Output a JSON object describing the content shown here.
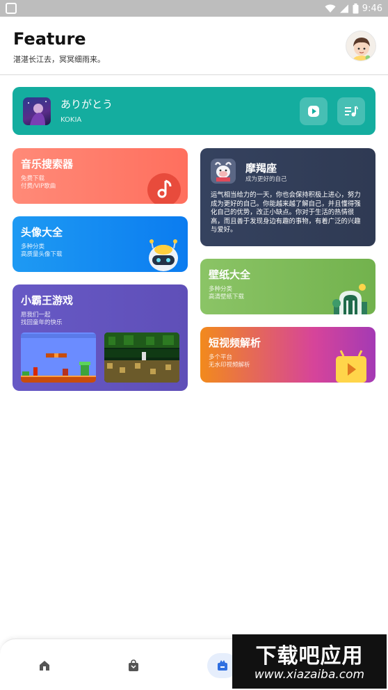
{
  "status_bar": {
    "time": "9:46"
  },
  "header": {
    "title": "Feature",
    "subtitle": "湛湛长江去，冥冥细雨来。"
  },
  "player": {
    "song_title": "ありがとう",
    "artist": "KOKIA",
    "play_icon": "play-icon",
    "playlist_icon": "playlist-icon"
  },
  "cards": {
    "music_search": {
      "title": "音乐搜索器",
      "line1": "免费下载",
      "line2": "付费/VIP歌曲"
    },
    "avatars": {
      "title": "头像大全",
      "line1": "多种分类",
      "line2": "高质量头像下载"
    },
    "games": {
      "title": "小霸王游戏",
      "line1": "愿我们一起",
      "line2": "找回童年的快乐"
    },
    "horoscope": {
      "name": "摩羯座",
      "sub": "成为更好的自己",
      "text": "运气相当给力的一天，你也会保持积极上进心，努力成为更好的自己。你能越来越了解自己，并且懂得强化自己的优势，改正小缺点。你对于生活的热情很高，而且善于发现身边有趣的事物，有着广泛的兴趣与爱好。"
    },
    "wallpaper": {
      "title": "壁纸大全",
      "line1": "多种分类",
      "line2": "高清壁纸下载"
    },
    "video": {
      "title": "短视频解析",
      "line1": "多个平台",
      "line2": "无水印视频解析"
    }
  },
  "bottom_nav": {
    "items": [
      {
        "icon": "home-icon"
      },
      {
        "icon": "shopping-bag-icon"
      },
      {
        "icon": "feature-icon",
        "active": true
      },
      {
        "icon": "profile-icon"
      }
    ]
  },
  "watermark": {
    "main": "下载吧应用",
    "url": "www.xiazaiba.com"
  }
}
